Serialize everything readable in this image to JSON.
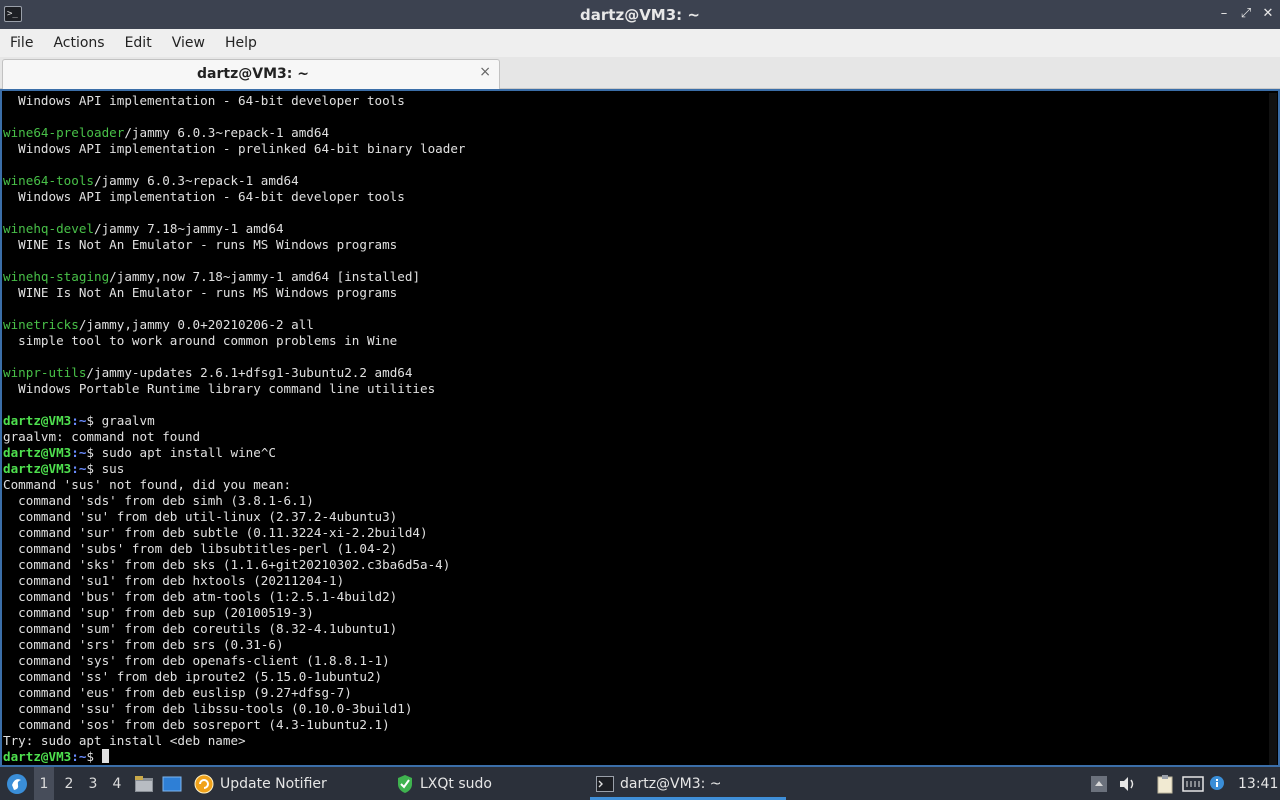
{
  "window": {
    "title": "dartz@VM3: ~",
    "minimize_glyph": "–",
    "maximize_glyph": "⤢",
    "close_glyph": "✕"
  },
  "menu": [
    "File",
    "Actions",
    "Edit",
    "View",
    "Help"
  ],
  "tab": {
    "label": "dartz@VM3: ~",
    "close_glyph": "×"
  },
  "terminal": {
    "prompt_user": "dartz@VM3",
    "prompt_path": ":~",
    "prompt_sym": "$ ",
    "lines": [
      {
        "t": "text",
        "text": "  Windows API implementation - 64-bit developer tools"
      },
      {
        "t": "blank"
      },
      {
        "t": "pkg",
        "name": "wine64-preloader",
        "rest": "/jammy 6.0.3~repack-1 amd64"
      },
      {
        "t": "text",
        "text": "  Windows API implementation - prelinked 64-bit binary loader"
      },
      {
        "t": "blank"
      },
      {
        "t": "pkg",
        "name": "wine64-tools",
        "rest": "/jammy 6.0.3~repack-1 amd64"
      },
      {
        "t": "text",
        "text": "  Windows API implementation - 64-bit developer tools"
      },
      {
        "t": "blank"
      },
      {
        "t": "pkg",
        "name": "winehq-devel",
        "rest": "/jammy 7.18~jammy-1 amd64"
      },
      {
        "t": "text",
        "text": "  WINE Is Not An Emulator - runs MS Windows programs"
      },
      {
        "t": "blank"
      },
      {
        "t": "pkg",
        "name": "winehq-staging",
        "rest": "/jammy,now 7.18~jammy-1 amd64 [installed]"
      },
      {
        "t": "text",
        "text": "  WINE Is Not An Emulator - runs MS Windows programs"
      },
      {
        "t": "blank"
      },
      {
        "t": "pkg",
        "name": "winetricks",
        "rest": "/jammy,jammy 0.0+20210206-2 all"
      },
      {
        "t": "text",
        "text": "  simple tool to work around common problems in Wine"
      },
      {
        "t": "blank"
      },
      {
        "t": "pkg",
        "name": "winpr-utils",
        "rest": "/jammy-updates 2.6.1+dfsg1-3ubuntu2.2 amd64"
      },
      {
        "t": "text",
        "text": "  Windows Portable Runtime library command line utilities"
      },
      {
        "t": "blank"
      },
      {
        "t": "prompt",
        "cmd": "graalvm"
      },
      {
        "t": "text",
        "text": "graalvm: command not found"
      },
      {
        "t": "prompt",
        "cmd": "sudo apt install wine^C"
      },
      {
        "t": "prompt",
        "cmd": "sus"
      },
      {
        "t": "text",
        "text": "Command 'sus' not found, did you mean:"
      },
      {
        "t": "text",
        "text": "  command 'sds' from deb simh (3.8.1-6.1)"
      },
      {
        "t": "text",
        "text": "  command 'su' from deb util-linux (2.37.2-4ubuntu3)"
      },
      {
        "t": "text",
        "text": "  command 'sur' from deb subtle (0.11.3224-xi-2.2build4)"
      },
      {
        "t": "text",
        "text": "  command 'subs' from deb libsubtitles-perl (1.04-2)"
      },
      {
        "t": "text",
        "text": "  command 'sks' from deb sks (1.1.6+git20210302.c3ba6d5a-4)"
      },
      {
        "t": "text",
        "text": "  command 'su1' from deb hxtools (20211204-1)"
      },
      {
        "t": "text",
        "text": "  command 'bus' from deb atm-tools (1:2.5.1-4build2)"
      },
      {
        "t": "text",
        "text": "  command 'sup' from deb sup (20100519-3)"
      },
      {
        "t": "text",
        "text": "  command 'sum' from deb coreutils (8.32-4.1ubuntu1)"
      },
      {
        "t": "text",
        "text": "  command 'srs' from deb srs (0.31-6)"
      },
      {
        "t": "text",
        "text": "  command 'sys' from deb openafs-client (1.8.8.1-1)"
      },
      {
        "t": "text",
        "text": "  command 'ss' from deb iproute2 (5.15.0-1ubuntu2)"
      },
      {
        "t": "text",
        "text": "  command 'eus' from deb euslisp (9.27+dfsg-7)"
      },
      {
        "t": "text",
        "text": "  command 'ssu' from deb libssu-tools (0.10.0-3build1)"
      },
      {
        "t": "text",
        "text": "  command 'sos' from deb sosreport (4.3-1ubuntu2.1)"
      },
      {
        "t": "text",
        "text": "Try: sudo apt install <deb name>"
      },
      {
        "t": "prompt",
        "cmd": "",
        "cursor": true
      }
    ]
  },
  "taskbar": {
    "desktops": [
      "1",
      "2",
      "3",
      "4"
    ],
    "tasks": [
      {
        "label": "Update Notifier",
        "icon": "update-notifier-icon"
      },
      {
        "label": "LXQt sudo",
        "icon": "shield-icon"
      },
      {
        "label": "dartz@VM3: ~",
        "icon": "terminal-icon",
        "active": true
      }
    ],
    "clock": "13:41"
  }
}
